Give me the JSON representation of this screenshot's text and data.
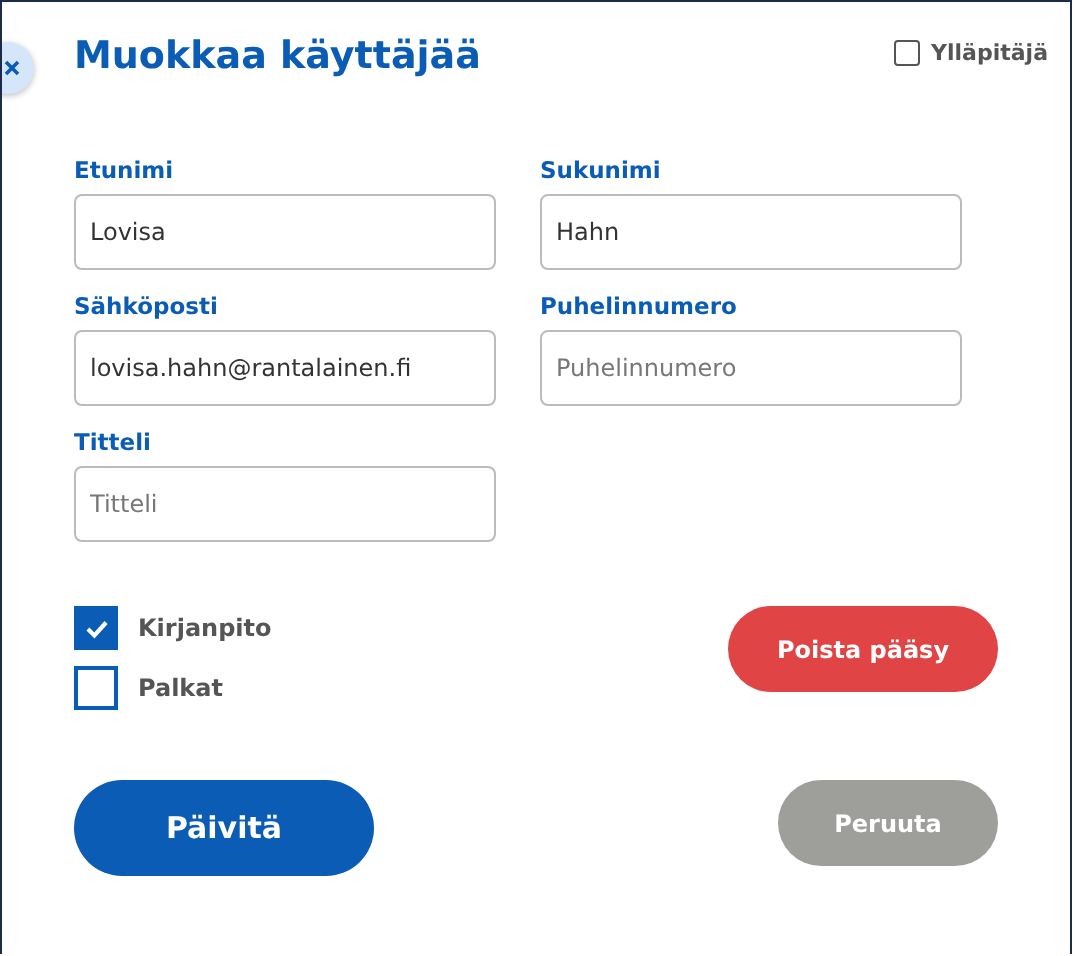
{
  "dialog": {
    "title": "Muokkaa käyttäjää",
    "admin": {
      "label": "Ylläpitäjä",
      "checked": false
    }
  },
  "fields": [
    {
      "label": "Etunimi",
      "value": "Lovisa"
    },
    {
      "label": "Sukunimi",
      "value": "Hahn"
    },
    {
      "label": "Sähköposti",
      "value": "lovisa.hahn@rantalainen.fi"
    },
    {
      "label": "Puhelinnumero",
      "placeholder": "Puhelinnumero"
    },
    {
      "label": "Titteli",
      "placeholder": "Titteli"
    }
  ],
  "permissions": [
    {
      "label": "Kirjanpito",
      "checked": true
    },
    {
      "label": "Palkat",
      "checked": false
    }
  ],
  "buttons": {
    "remove": "Poista pääsy",
    "update": "Päivitä",
    "cancel": "Peruuta"
  }
}
